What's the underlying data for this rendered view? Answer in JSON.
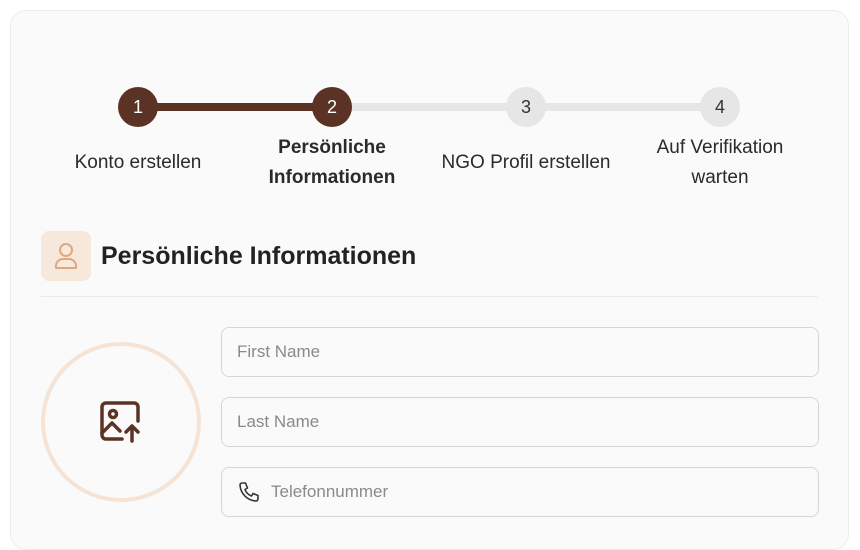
{
  "stepper": {
    "steps": [
      {
        "number": "1",
        "label": "Konto erstellen"
      },
      {
        "number": "2",
        "label_line1": "Persönliche",
        "label_line2": "Informationen"
      },
      {
        "number": "3",
        "label": "NGO Profil erstellen"
      },
      {
        "number": "4",
        "label_line1": "Auf Verifikation",
        "label_line2": "warten"
      }
    ],
    "current_step": 2
  },
  "section": {
    "icon": "user-icon",
    "title": "Persönliche Informationen"
  },
  "avatar_upload": {
    "icon": "image-upload-icon"
  },
  "form": {
    "first_name": {
      "placeholder": "First Name",
      "value": ""
    },
    "last_name": {
      "placeholder": "Last Name",
      "value": ""
    },
    "phone": {
      "placeholder": "Telefonnummer",
      "value": "",
      "icon": "phone-icon"
    }
  },
  "colors": {
    "accent": "#5b3324",
    "accent_light": "#f7e8dc",
    "inactive": "#e6e6e6"
  }
}
